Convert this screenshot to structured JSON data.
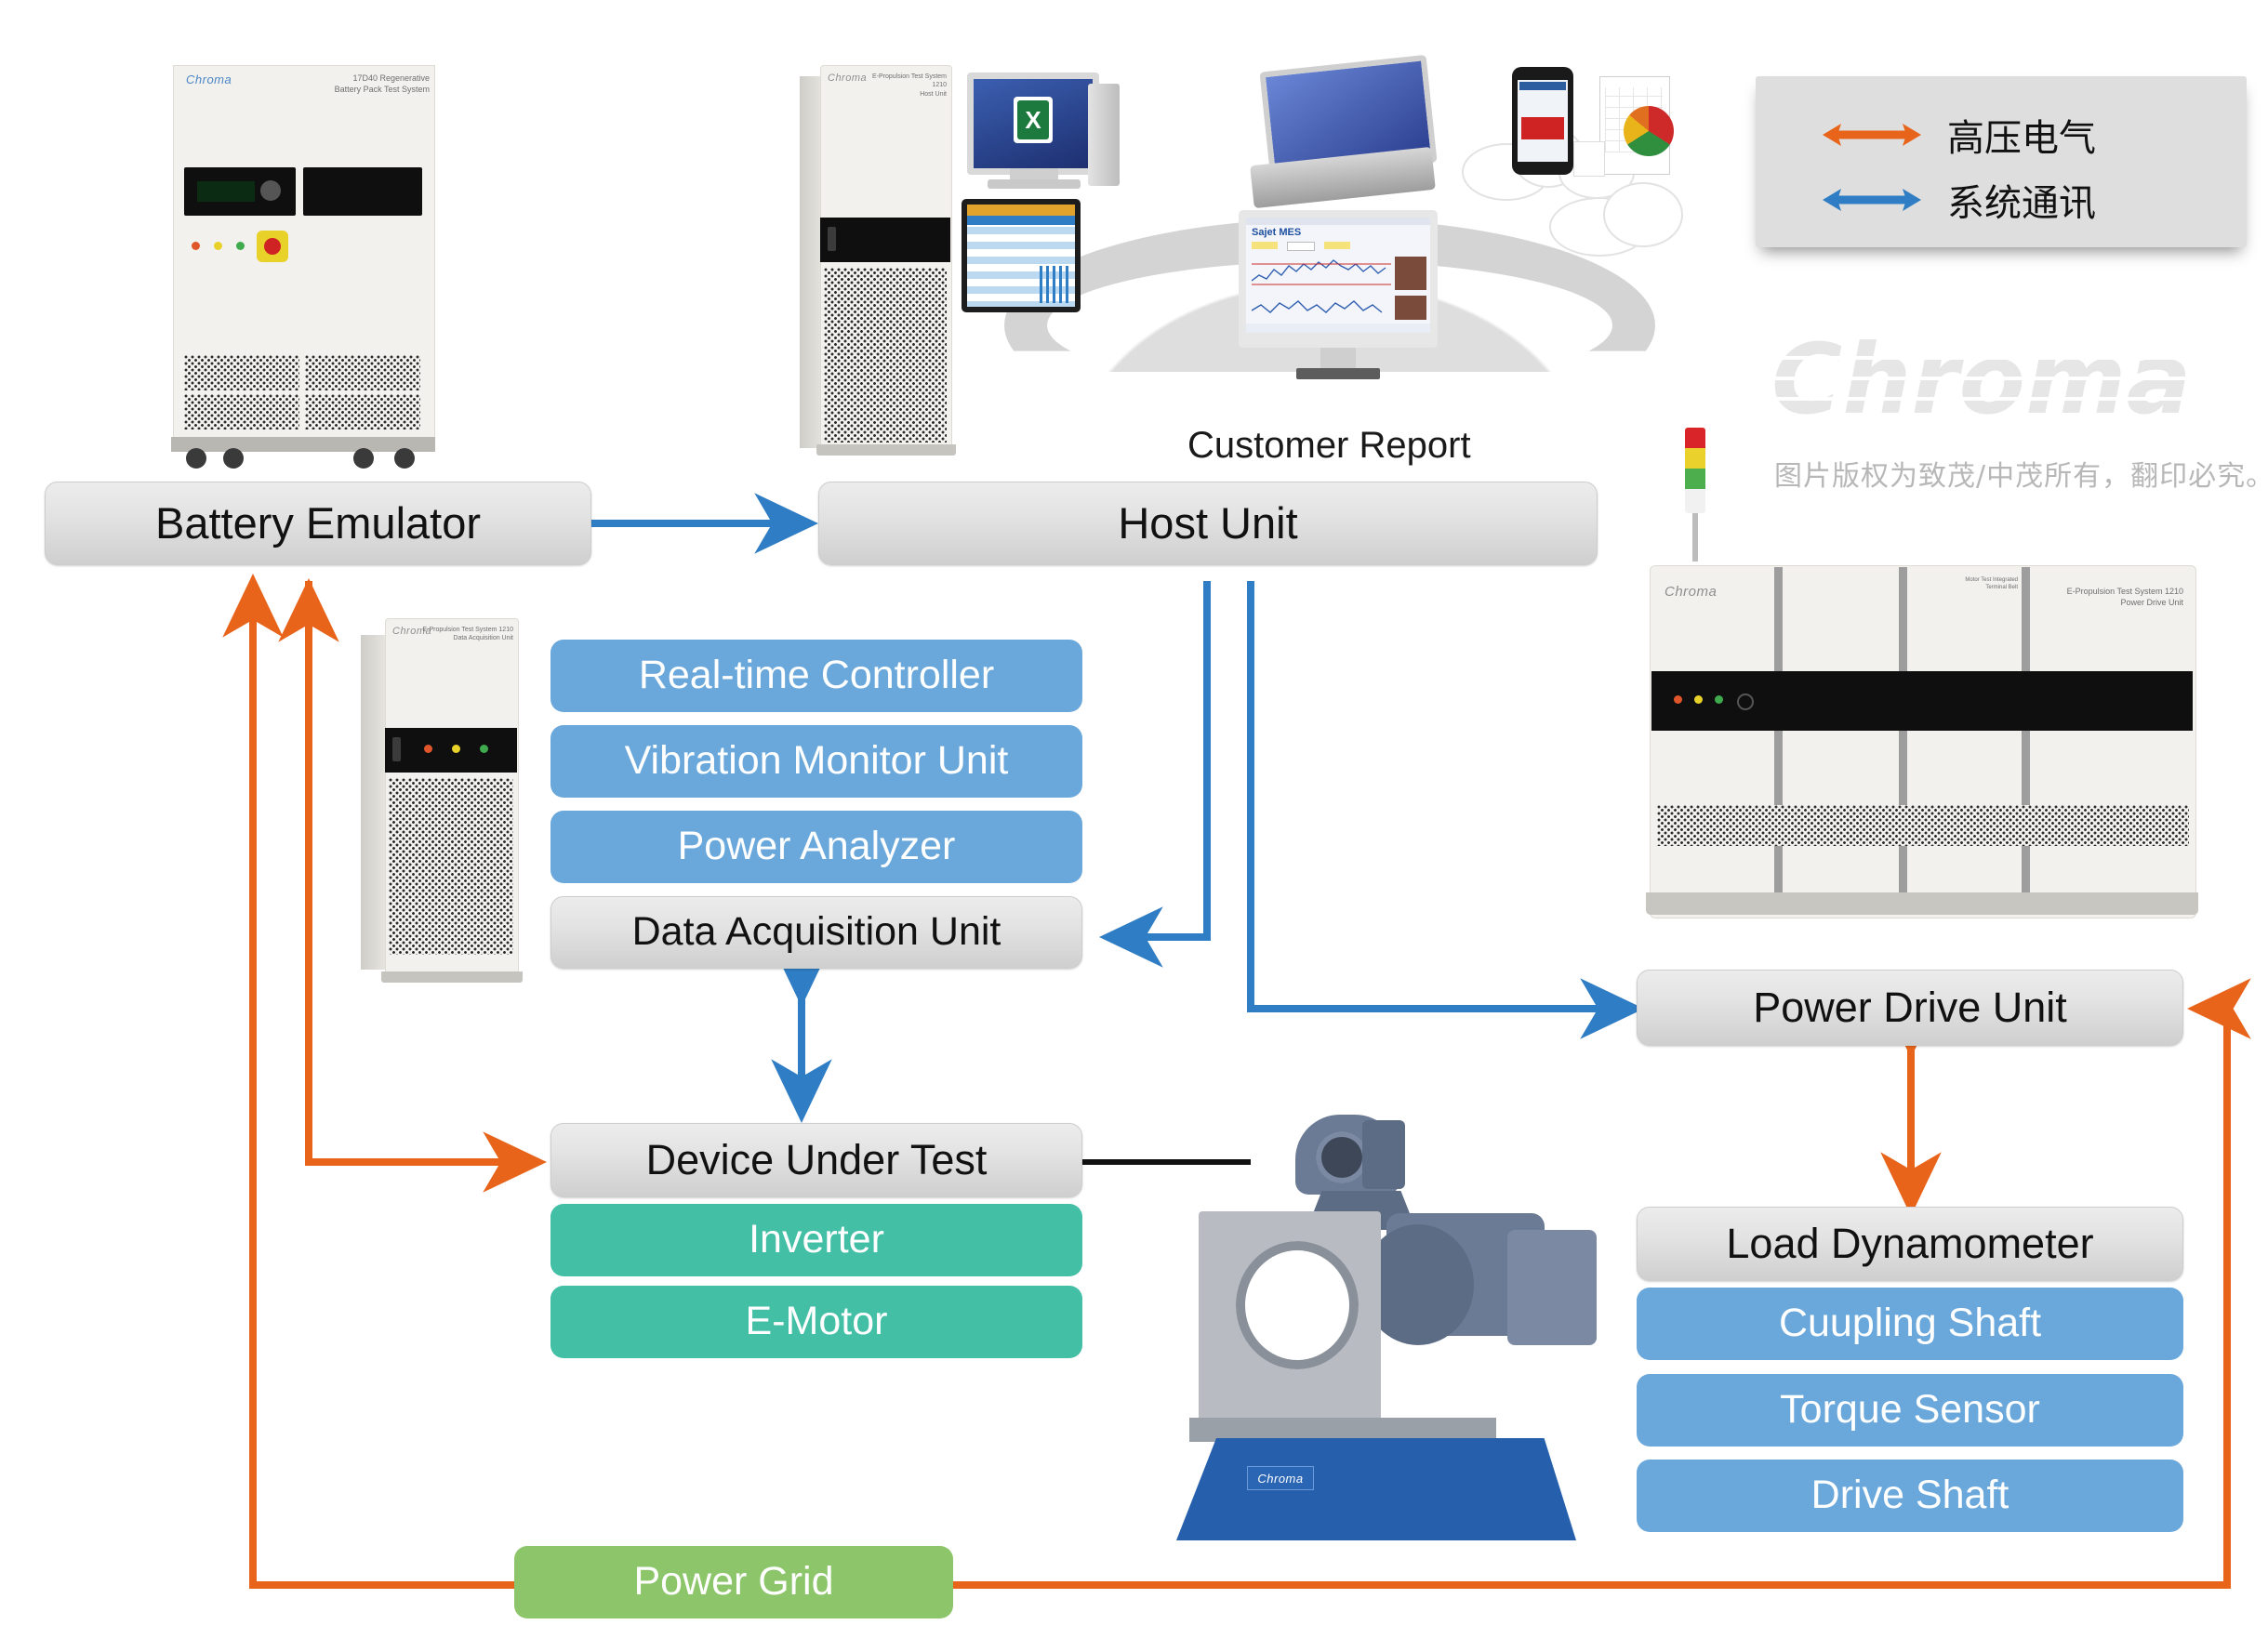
{
  "diagram": {
    "title_hidden": "",
    "nodes": {
      "battery_emulator": "Battery Emulator",
      "host_unit": "Host Unit",
      "real_time_controller": "Real-time Controller",
      "vibration_monitor_unit": "Vibration Monitor Unit",
      "power_analyzer": "Power Analyzer",
      "data_acquisition_unit": "Data Acquisition Unit",
      "device_under_test": "Device Under Test",
      "inverter": "Inverter",
      "e_motor": "E-Motor",
      "power_drive_unit": "Power Drive Unit",
      "load_dynamometer": "Load Dynamometer",
      "coupling_shaft": "Cuupling Shaft",
      "torque_sensor": "Torque Sensor",
      "drive_shaft": "Drive Shaft",
      "power_grid": "Power Grid"
    },
    "captions": {
      "customer_report": "Customer Report"
    }
  },
  "legend": {
    "items": [
      {
        "label": "高压电气",
        "color": "#e8641a"
      },
      {
        "label": "系统通讯",
        "color": "#2f7dc4"
      }
    ]
  },
  "watermark": {
    "brand": "Chroma",
    "copyright": "图片版权为致茂/中茂所有，翻印必究。"
  },
  "equipment_labels": {
    "battery_cabinet_brand": "Chroma",
    "battery_cabinet_model": "17D40 Regenerative\nBattery Pack Test System",
    "host_cabinet_brand": "Chroma",
    "host_cabinet_model": "E-Propulsion Test System 1210\nHost Unit",
    "daq_cabinet_brand": "Chroma",
    "daq_cabinet_model": "E-Propulsion Test System 1210\nData Acquisition Unit",
    "pdu_cabinet_brand": "Chroma",
    "pdu_cabinet_model": "E-Propulsion Test System 1210\nPower Drive Unit",
    "pdu_cabinet_model_mid": "Motor Test Integrated\nTerminal Belt",
    "dyno_brand": "Chroma",
    "monitor_app_title": "Sajet MES"
  },
  "colors": {
    "hv_orange": "#e8641a",
    "comm_blue": "#2f7dc4",
    "node_blue": "#6aa8dc",
    "node_green": "#42bfa5",
    "grid_green": "#8dc66a",
    "node_gray": "#dcdcdc"
  }
}
